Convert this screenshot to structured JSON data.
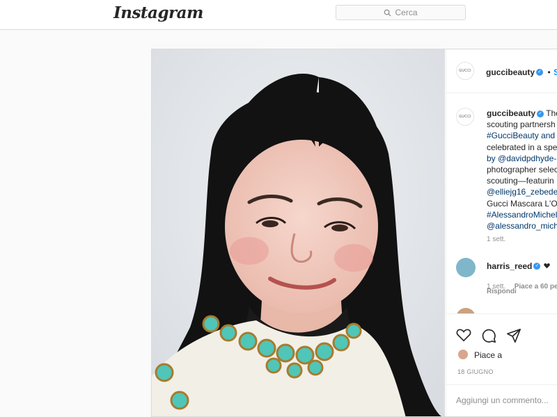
{
  "app": {
    "logo_text": "Instagram",
    "search_placeholder": "Cerca"
  },
  "post": {
    "username": "guccibeauty",
    "follow_dot": "•",
    "follow_label": "S",
    "avatar_text": "GUCCI",
    "caption": {
      "username": "guccibeauty",
      "lines": [
        "The",
        "scouting partnersh",
        "#GucciBeauty and",
        "celebrated in a spe",
        "by @davidpdhyde-",
        "photographer selec",
        "scouting—featurin",
        "@elliejg16_zebede",
        "Gucci Mascara L'Ob",
        "#AlessandroMichel",
        "@alessandro_mich"
      ],
      "time": "1 sett."
    },
    "comments": [
      {
        "username": "harris_reed",
        "time": "1 sett.",
        "likes": "Piace a 60 pe",
        "reply": "Rispondi"
      }
    ],
    "likes_text": "Piace a",
    "date": "18 GIUGNO",
    "comment_placeholder": "Aggiungi un commento...",
    "icons": [
      "heart-icon",
      "comment-icon",
      "share-icon",
      "search-icon",
      "verified-badge"
    ]
  }
}
